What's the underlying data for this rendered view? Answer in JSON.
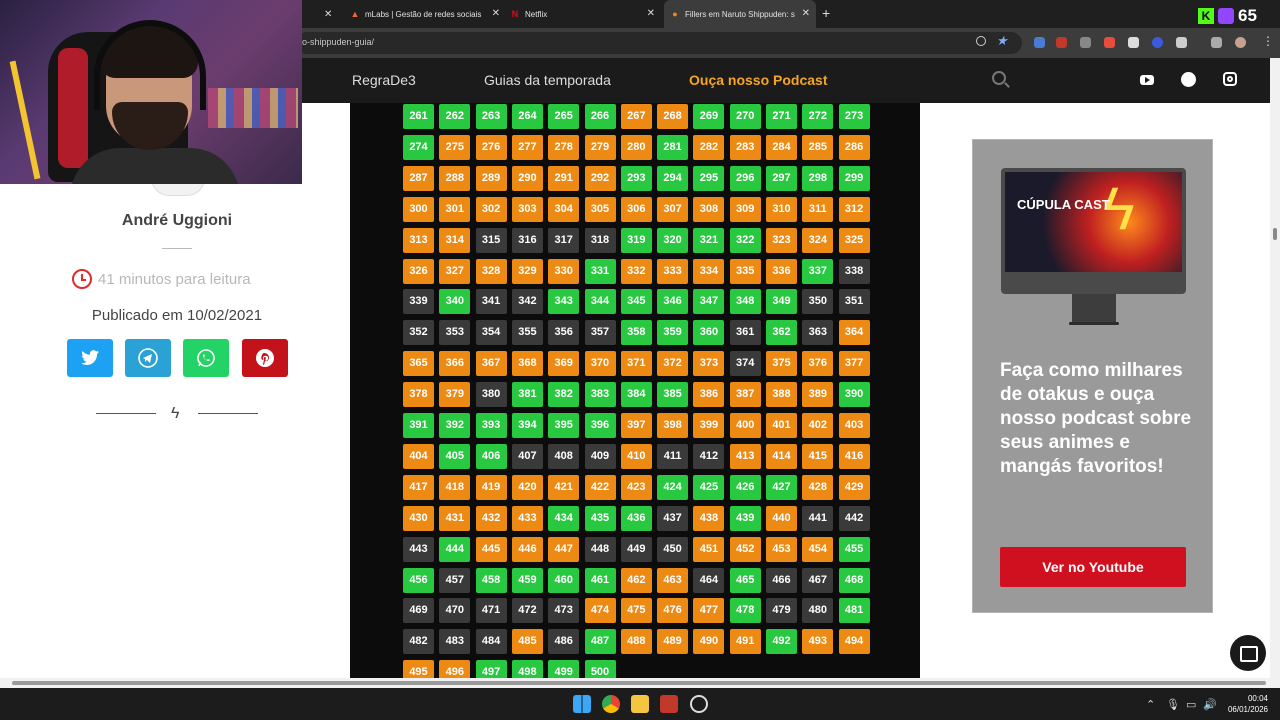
{
  "browser": {
    "tabs": [
      {
        "label": "mLabs | Gestão de redes sociais",
        "icon": "mlabs-icon",
        "active": false
      },
      {
        "label": "Netflix",
        "icon": "netflix-icon",
        "active": false
      },
      {
        "label": "Fillers em Naruto Shippuden: s",
        "icon": "site-icon",
        "active": true
      }
    ],
    "url": "o-shippuden-guia/",
    "viewer_count": "65"
  },
  "site_header": {
    "nav": [
      {
        "label": "RegraDe3",
        "highlight": false
      },
      {
        "label": "Guias da temporada",
        "highlight": false
      },
      {
        "label": "Ouça nosso Podcast",
        "highlight": true
      }
    ]
  },
  "sidebar": {
    "author": "André Uggioni",
    "read_time": "41 minutos para leitura",
    "published": "Publicado em 10/02/2021",
    "share_buttons": [
      "twitter",
      "telegram",
      "whatsapp",
      "pinterest"
    ]
  },
  "episode_grid": {
    "start": 261,
    "end": 500,
    "legend_colors": {
      "canon": "#28c840",
      "filler": "#ec8a14",
      "mixed": "#3a3a3a"
    },
    "types": "ccccccffccccccffffffcfffffffffffcccccccfffffffffffffffmmmmccccffffffffcfffffcmmcmmcccccccmmmmmmmmcccmcmffffffffffmfffffmcccccffffcccccccffffffffccmmmfmmfffffffffffccccffffffcccmfcfmmmcfffmmmffffccmccccffmcmmcmmmmmffffcmmcmmmfmcffffcffffcccccccmmmmmcmmccccmmm"
  },
  "ad": {
    "screen_title": "CÚPULA CAST",
    "text": "Faça como milhares de otakus e ouça nosso podcast sobre seus animes e mangás favoritos!",
    "button": "Ver no Youtube"
  },
  "taskbar": {
    "time": "00:04",
    "date": "06/01/2026"
  }
}
